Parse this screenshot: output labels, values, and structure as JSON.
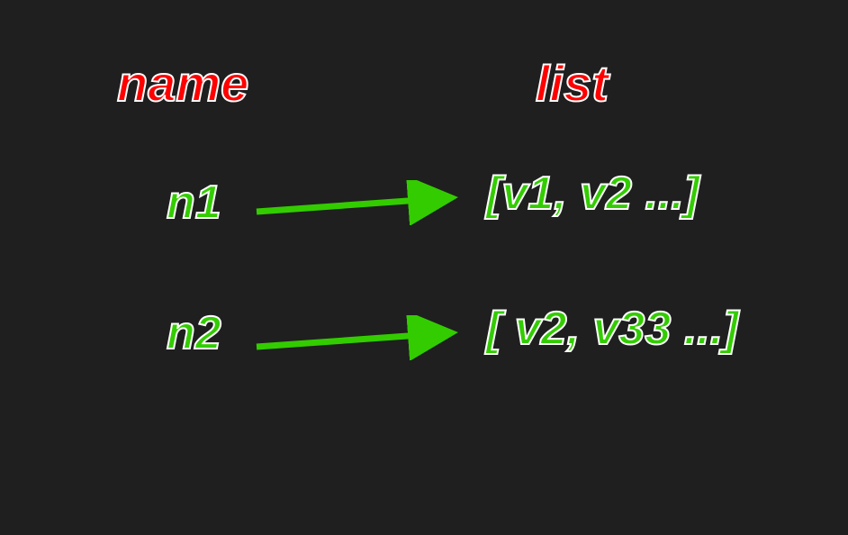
{
  "headers": {
    "name": "name",
    "list": "list"
  },
  "rows": [
    {
      "name": "n1",
      "list": "[v1, v2 ...]"
    },
    {
      "name": "n2",
      "list": "[ v2, v33 ...]"
    }
  ],
  "colors": {
    "background": "#1f1f1f",
    "header": "#ff0000",
    "content": "#33cc00",
    "arrow": "#33cc00",
    "outline": "#ffffff"
  }
}
